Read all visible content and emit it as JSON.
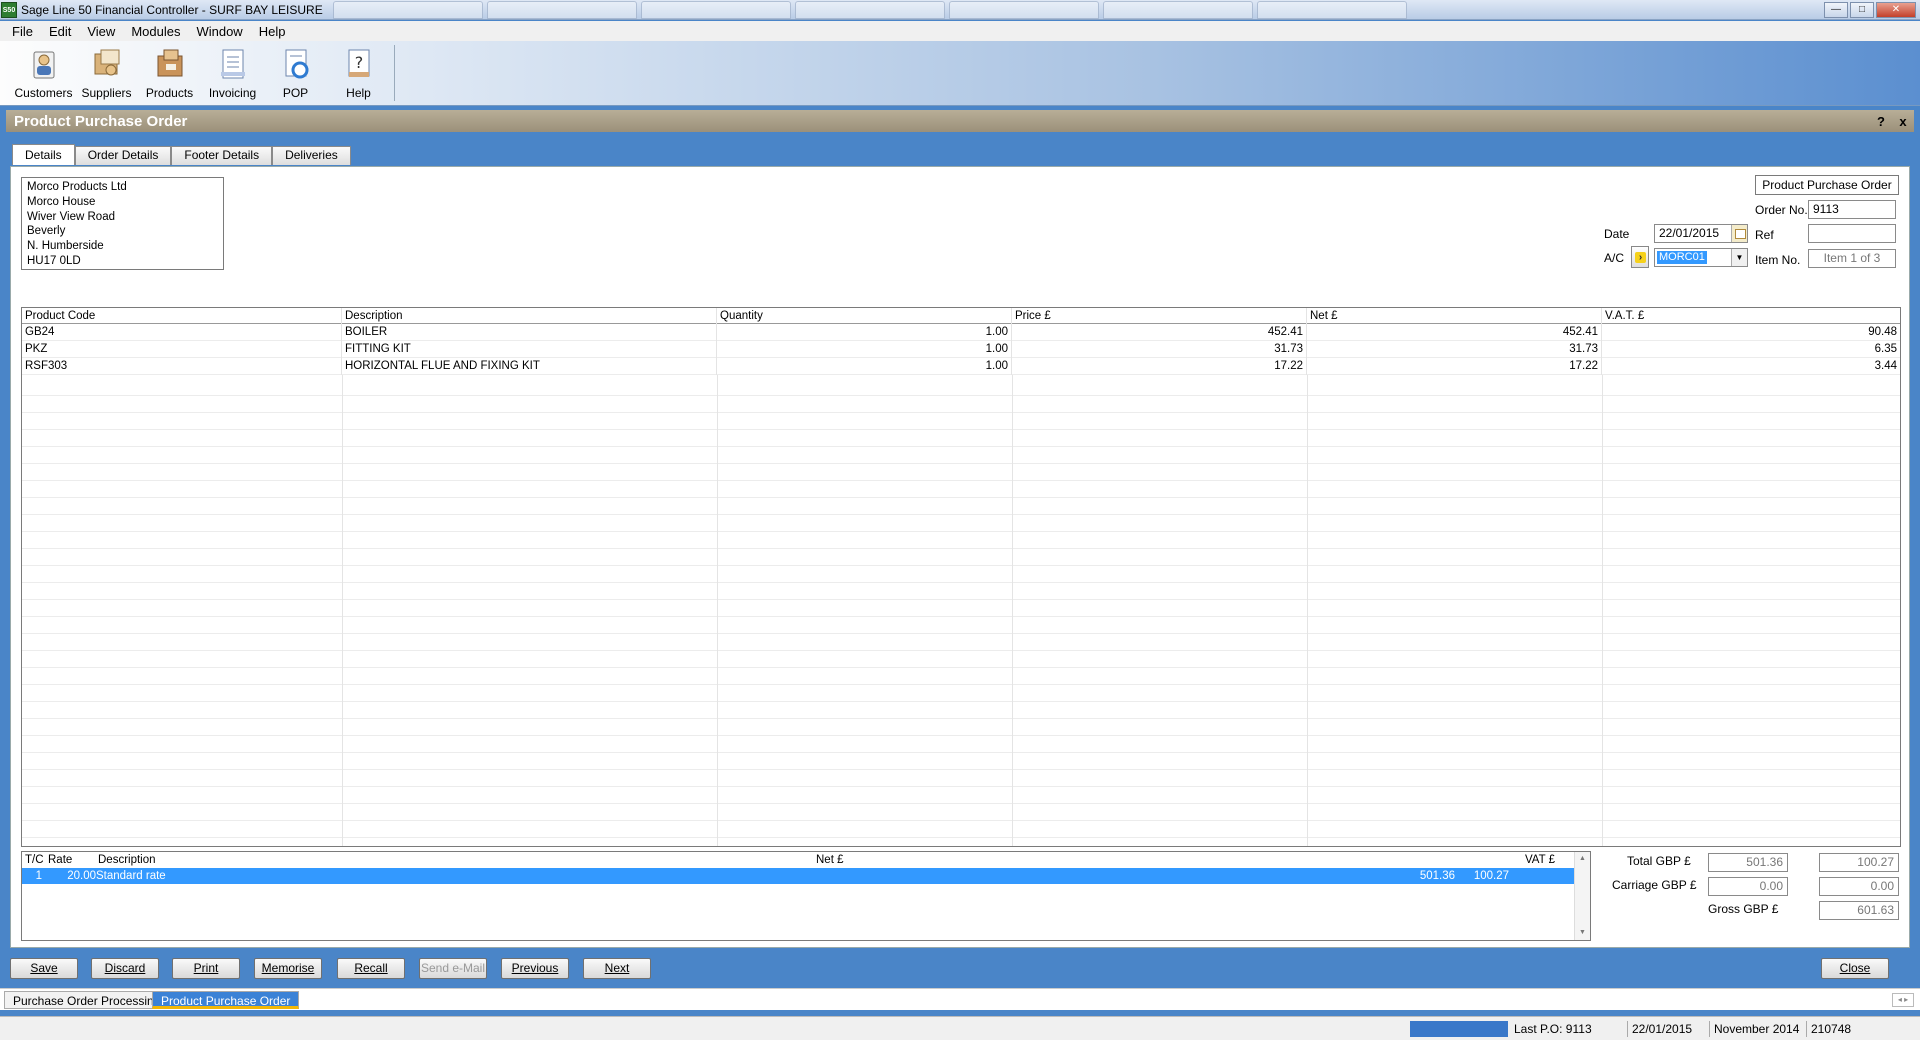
{
  "app": {
    "title": "Sage Line 50 Financial Controller - SURF BAY LEISURE",
    "icon_text": "S50"
  },
  "menu": [
    "File",
    "Edit",
    "View",
    "Modules",
    "Window",
    "Help"
  ],
  "toolbar": [
    {
      "label": "Customers",
      "icon": "customers-icon"
    },
    {
      "label": "Suppliers",
      "icon": "suppliers-icon"
    },
    {
      "label": "Products",
      "icon": "products-icon"
    },
    {
      "label": "Invoicing",
      "icon": "invoicing-icon"
    },
    {
      "label": "POP",
      "icon": "pop-icon"
    },
    {
      "label": "Help",
      "icon": "help-icon"
    }
  ],
  "window": {
    "title": "Product Purchase Order",
    "help_btn": "?",
    "close_btn": "x"
  },
  "tabs": [
    "Details",
    "Order Details",
    "Footer Details",
    "Deliveries"
  ],
  "address": [
    "Morco Products Ltd",
    "Morco House",
    "Wiver View Road",
    "Beverly",
    "N. Humberside",
    "HU17 0LD"
  ],
  "header": {
    "doc_type": "Product Purchase Order",
    "order_no_label": "Order No.",
    "order_no": "9113",
    "date_label": "Date",
    "date": "22/01/2015",
    "ref_label": "Ref",
    "ref": "",
    "ac_label": "A/C",
    "ac": "MORC01",
    "item_no_label": "Item No.",
    "item_no": "Item 1 of 3"
  },
  "grid": {
    "columns": [
      "Product Code",
      "Description",
      "Quantity",
      "Price £",
      "Net £",
      "V.A.T. £"
    ],
    "rows": [
      [
        "GB24",
        "BOILER",
        "1.00",
        "452.41",
        "452.41",
        "90.48"
      ],
      [
        "PKZ",
        "FITTING KIT",
        "1.00",
        "31.73",
        "31.73",
        "6.35"
      ],
      [
        "RSF303",
        "HORIZONTAL FLUE AND FIXING KIT",
        "1.00",
        "17.22",
        "17.22",
        "3.44"
      ]
    ]
  },
  "vat": {
    "columns": [
      "T/C",
      "Rate",
      "Description",
      "Net £",
      "VAT £"
    ],
    "rows": [
      [
        "1",
        "20.00",
        "Standard rate",
        "501.36",
        "100.27"
      ]
    ]
  },
  "totals": {
    "total_label": "Total GBP £",
    "total_net": "501.36",
    "total_vat": "100.27",
    "carriage_label": "Carriage GBP £",
    "carriage_net": "0.00",
    "carriage_vat": "0.00",
    "gross_label": "Gross GBP £",
    "gross": "601.63"
  },
  "buttons": [
    "Save",
    "Discard",
    "Print",
    "Memorise",
    "Recall",
    "Send e-Mail",
    "Previous",
    "Next"
  ],
  "close_label": "Close",
  "window_tabs": [
    "Purchase Order Processing",
    "Product Purchase Order"
  ],
  "status": {
    "last_po": "Last P.O: 9113",
    "date": "22/01/2015",
    "period": "November 2014",
    "code": "210748"
  }
}
